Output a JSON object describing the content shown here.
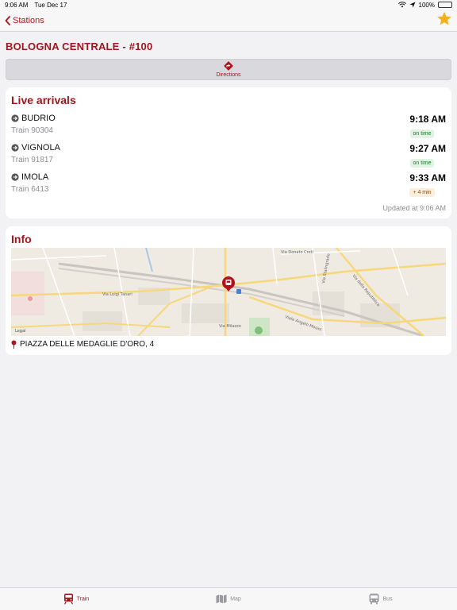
{
  "status_bar": {
    "time": "9:06 AM",
    "date": "Tue Dec 17",
    "battery": "100%"
  },
  "nav": {
    "back_label": "Stations",
    "accent": "#b3121c",
    "star_color": "#f3b21b"
  },
  "station": {
    "title": "BOLOGNA CENTRALE - #100"
  },
  "directions": {
    "label": "Directions"
  },
  "live_arrivals": {
    "title": "Live arrivals",
    "items": [
      {
        "destination": "BUDRIO",
        "train": "Train 90304",
        "time": "9:18 AM",
        "status": "on time"
      },
      {
        "destination": "VIGNOLA",
        "train": "Train 91817",
        "time": "9:27 AM",
        "status": "on time"
      },
      {
        "destination": "IMOLA",
        "train": "Train 6413",
        "time": "9:33 AM",
        "status": "+ 4 min"
      }
    ],
    "updated": "Updated at 9:06 AM"
  },
  "info": {
    "title": "Info",
    "map_labels": {
      "street1": "Via Donato Creti",
      "street2": "Viale Angelo Masini",
      "street3": "Via Luigi Tanari",
      "street4": "Via Milazzo",
      "street5": "Via della Repubblica",
      "street6": "Via Stalingrado",
      "legal": "Legal"
    },
    "address": "PIAZZA DELLE MEDAGLIE D'ORO, 4"
  },
  "tabs": [
    {
      "label": "Train",
      "icon": "train-icon",
      "active": true
    },
    {
      "label": "Map",
      "icon": "map-icon",
      "active": false
    },
    {
      "label": "Bus",
      "icon": "bus-icon",
      "active": false
    }
  ]
}
